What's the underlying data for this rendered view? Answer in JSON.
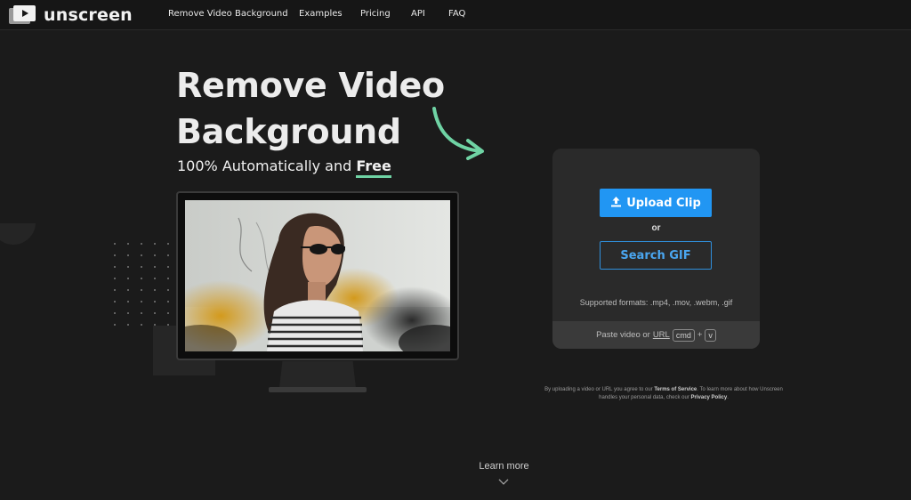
{
  "brand": {
    "name": "unscreen"
  },
  "nav": {
    "items": [
      "Remove Video Background",
      "Examples",
      "Pricing",
      "API",
      "FAQ"
    ]
  },
  "hero": {
    "title": "Remove Video Background",
    "subtitle_prefix": "100% Automatically and ",
    "subtitle_emphasis": "Free"
  },
  "upload": {
    "upload_label": "Upload Clip",
    "or_label": "or",
    "search_label": "Search GIF",
    "formats_text": "Supported formats: .mp4, .mov, .webm, .gif",
    "paste_prefix": "Paste video or",
    "paste_url": "URL",
    "key_cmd": "cmd",
    "key_plus": "+",
    "key_v": "v"
  },
  "legal": {
    "text1": "By uploading a video or URL you agree to our ",
    "terms": "Terms of Service",
    "text2": ". To learn more about how Unscreen handles your personal data, check our ",
    "privacy": "Privacy Policy",
    "text3": "."
  },
  "footer": {
    "learn_more": "Learn more"
  },
  "colors": {
    "accent_blue": "#2196f3",
    "accent_mint": "#6fd3a4",
    "background": "#1b1b1b",
    "card": "#2a2a2a"
  },
  "icons": [
    "logo-play-icon",
    "upload-icon",
    "curved-arrow-icon",
    "chevron-down-icon"
  ]
}
